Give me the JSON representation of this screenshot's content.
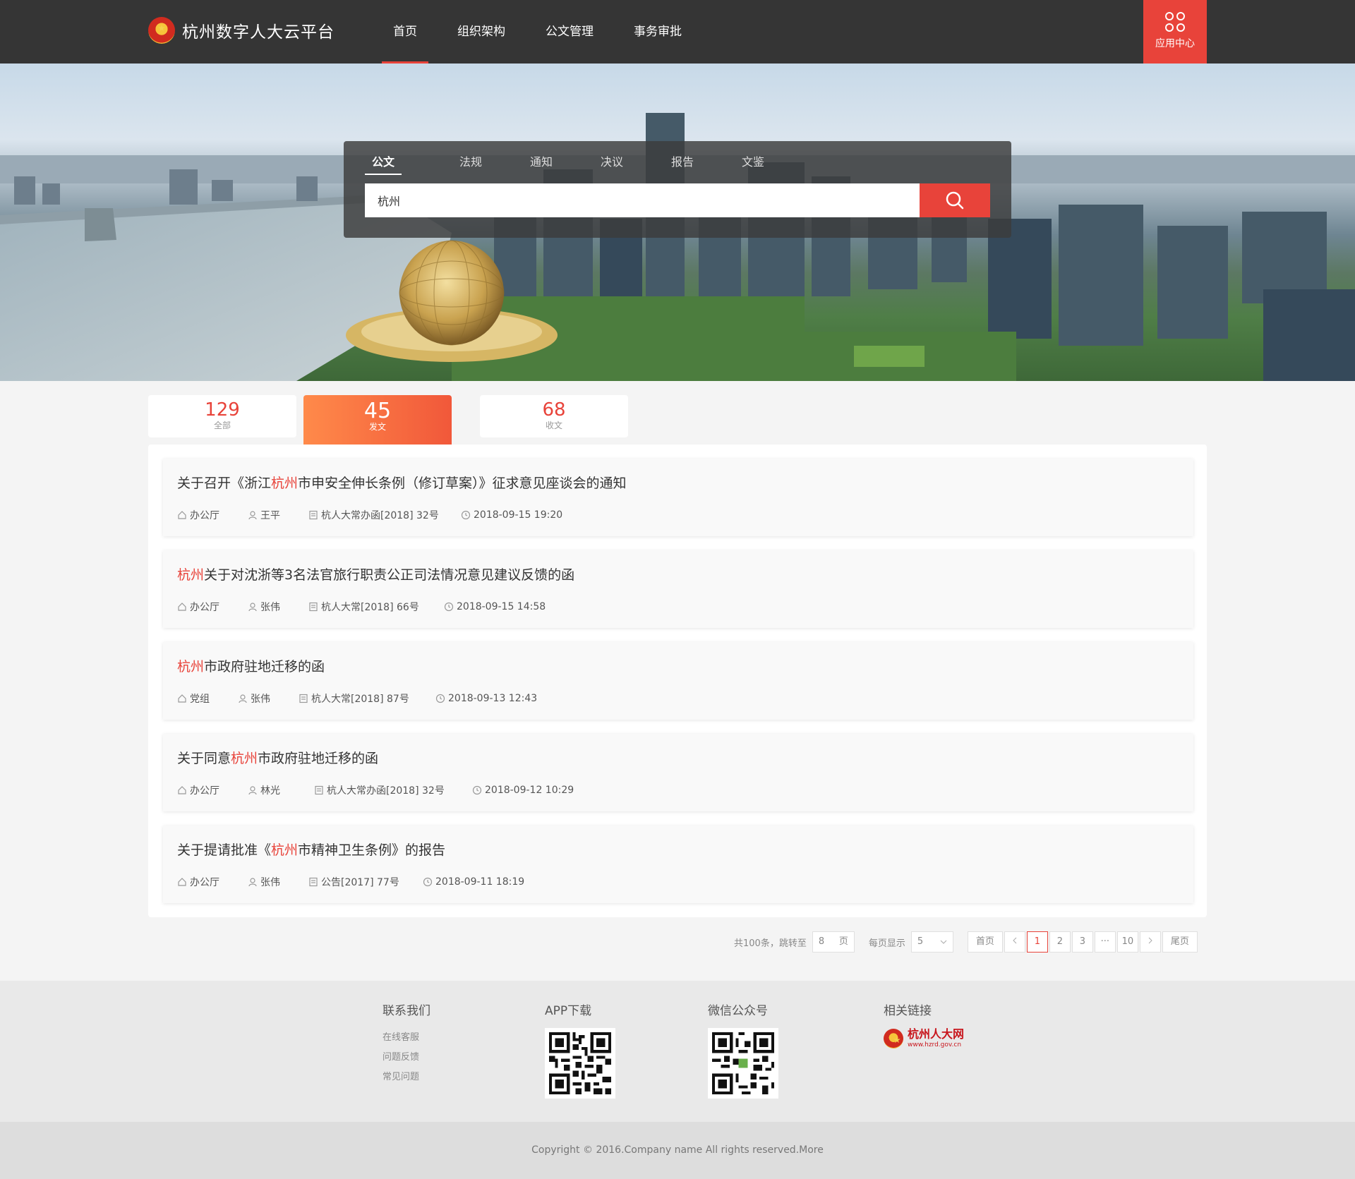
{
  "header": {
    "logo_text": "杭州数字人大云平台",
    "nav": [
      "首页",
      "组织架构",
      "公文管理",
      "事务审批"
    ],
    "app_center": "应用中心"
  },
  "search": {
    "tabs": [
      "公文",
      "法规",
      "通知",
      "决议",
      "报告",
      "文鉴"
    ],
    "value": "杭州"
  },
  "stats": [
    {
      "value": "129",
      "label": "全部"
    },
    {
      "value": "45",
      "label": "发文"
    },
    {
      "value": "68",
      "label": "收文"
    }
  ],
  "documents": [
    {
      "pre": "关于召开《浙江",
      "hl": "杭州",
      "post": "市申安全伸长条例（修订草案）》征求意见座谈会的通知",
      "dept": "办公厅",
      "person": "王平",
      "doc_no": "杭人大常办函[2018] 32号",
      "time": "2018-09-15 19:20"
    },
    {
      "pre": "",
      "hl": "杭州",
      "post": "关于对沈浙等3名法官旅行职责公正司法情况意见建议反馈的函",
      "dept": "办公厅",
      "person": "张伟",
      "doc_no": "杭人大常[2018]  66号",
      "time": "2018-09-15 14:58"
    },
    {
      "pre": "",
      "hl": "杭州",
      "post": "市政府驻地迁移的函",
      "dept": "党组",
      "person": "张伟",
      "doc_no": "杭人大常[2018]  87号",
      "time": "2018-09-13 12:43"
    },
    {
      "pre": "关于同意",
      "hl": "杭州",
      "post": "市政府驻地迁移的函",
      "dept": "办公厅",
      "person": "林光",
      "doc_no": "杭人大常办函[2018] 32号",
      "time": "2018-09-12 10:29"
    },
    {
      "pre": "关于提请批准《",
      "hl": "杭州",
      "post": "市精神卫生条例》的报告",
      "dept": "办公厅",
      "person": "张伟",
      "doc_no": "公告[2017] 77号",
      "time": "2018-09-11 18:19"
    }
  ],
  "pagination": {
    "total": "共100条，跳转至",
    "jump_value": "8",
    "jump_unit": "页",
    "per_page_label": "每页显示",
    "per_page_value": "5",
    "first": "首页",
    "pages": [
      "1",
      "2",
      "3",
      "···",
      "10"
    ],
    "last": "尾页"
  },
  "footer": {
    "contact_title": "联系我们",
    "contact_links": [
      "在线客服",
      "问题反馈",
      "常见问题"
    ],
    "app_title": "APP下载",
    "wechat_title": "微信公众号",
    "related_title": "相关链接",
    "related_logo_text": "杭州人大网",
    "related_logo_url": "www.hzrd.gov.cn",
    "copyright": "Copyright © 2016.Company name All rights reserved.More"
  },
  "colors": {
    "accent": "#e8433a",
    "header_bg": "#353535"
  }
}
